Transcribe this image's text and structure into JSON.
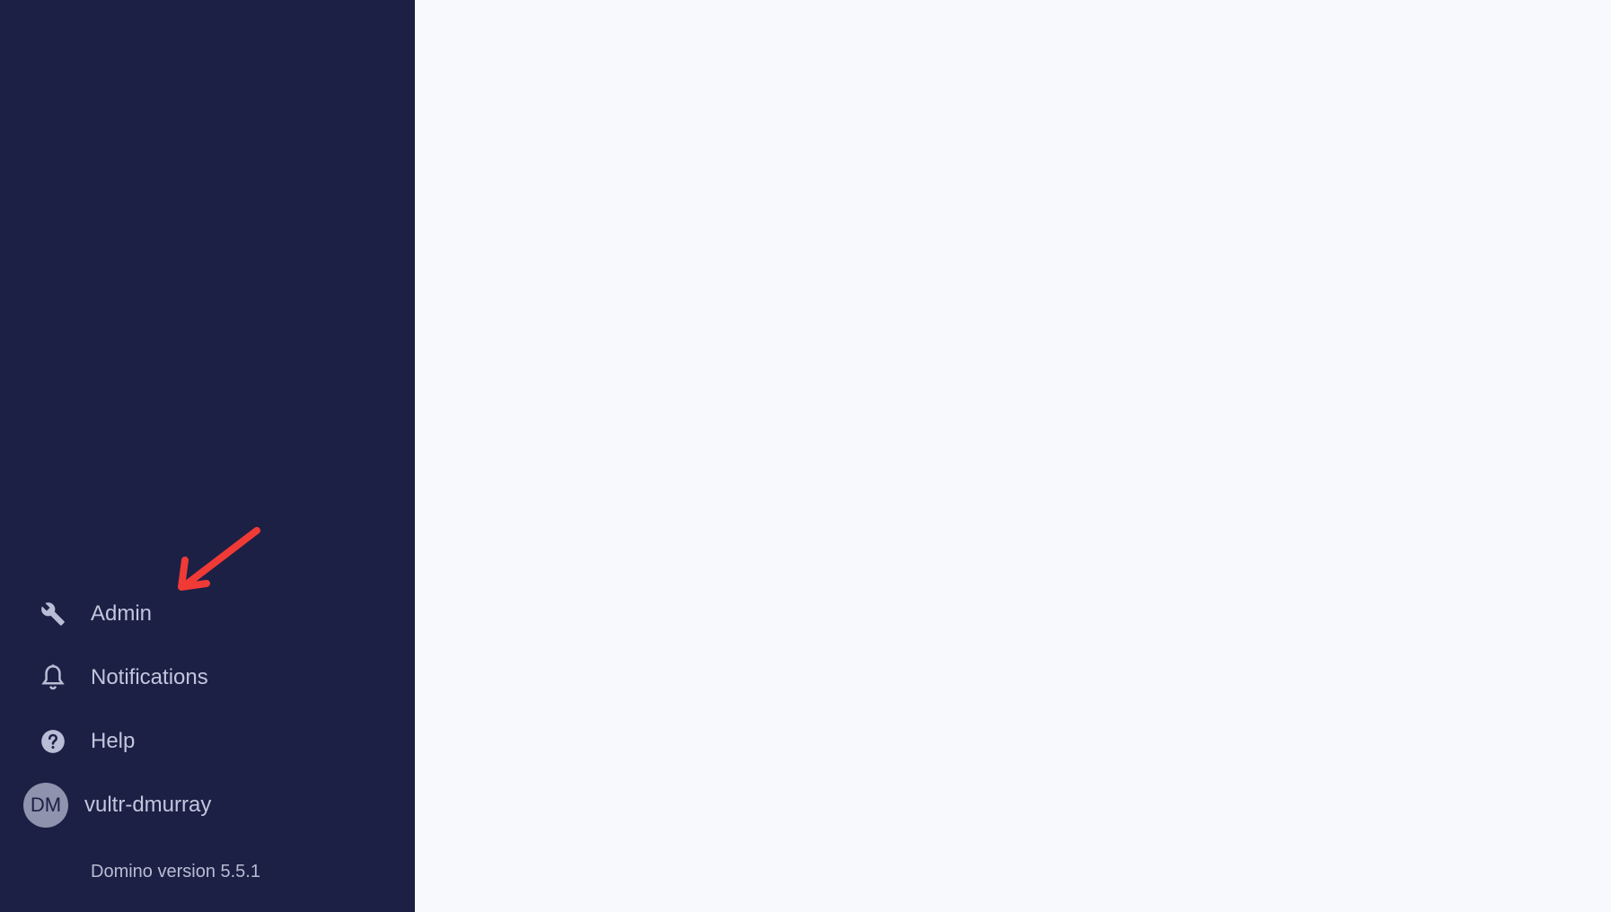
{
  "sidebar": {
    "items": [
      {
        "label": "Admin",
        "icon": "wrench-icon"
      },
      {
        "label": "Notifications",
        "icon": "bell-icon"
      },
      {
        "label": "Help",
        "icon": "help-circle-icon"
      }
    ],
    "user": {
      "initials": "DM",
      "name": "vultr-dmurray"
    },
    "version": "Domino version 5.5.1"
  },
  "annotation": {
    "icon": "red-arrow-icon",
    "color": "#f03a36"
  },
  "colors": {
    "sidebar_bg": "#1c2045",
    "main_bg": "#f8f9fc",
    "nav_text": "#c3c6dc",
    "avatar_bg": "#8f93ad"
  }
}
